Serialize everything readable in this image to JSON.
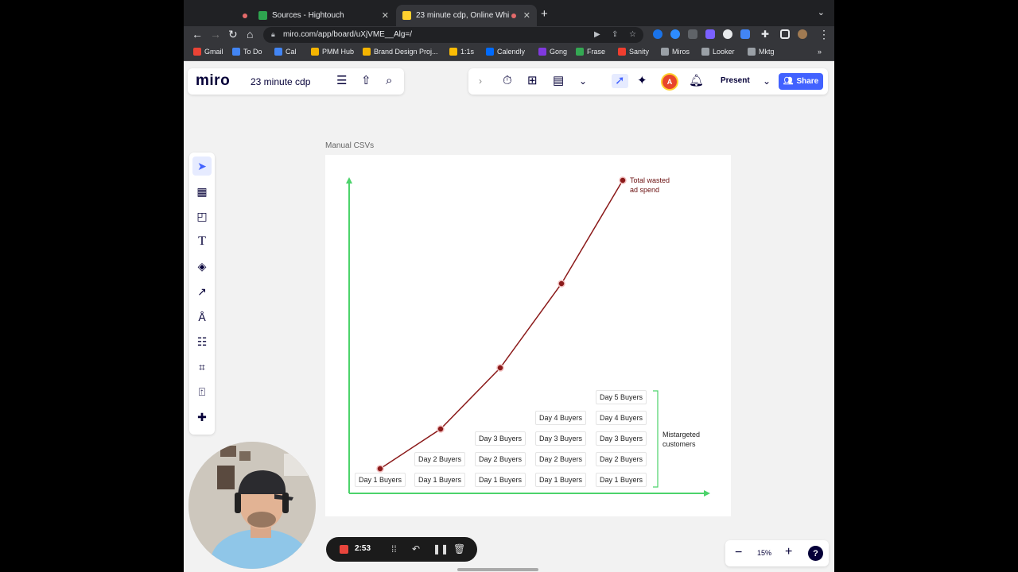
{
  "browser": {
    "tabs": [
      {
        "title": "Sources - Hightouch",
        "favicon_color": "#2ea44f"
      },
      {
        "title": "23 minute cdp, Online Whi",
        "favicon_color": "#ffd02f"
      }
    ],
    "url": "miro.com/app/board/uXjVME__Alg=/",
    "bookmarks": [
      {
        "label": "Gmail",
        "color": "#ea4335"
      },
      {
        "label": "To Do",
        "color": "#4285f4"
      },
      {
        "label": "Cal",
        "color": "#4285f4"
      },
      {
        "label": "PMM Hub",
        "color": "#f4b400"
      },
      {
        "label": "Brand Design Proj...",
        "color": "#f4b400"
      },
      {
        "label": "1:1s",
        "color": "#fbbc04"
      },
      {
        "label": "Calendly",
        "color": "#006bff"
      },
      {
        "label": "Gong",
        "color": "#8039df"
      },
      {
        "label": "Frase",
        "color": "#34a853"
      },
      {
        "label": "Sanity",
        "color": "#f03e2f"
      },
      {
        "label": "Miros",
        "color": "#9aa0a6"
      },
      {
        "label": "Looker",
        "color": "#9aa0a6"
      },
      {
        "label": "Mktg",
        "color": "#9aa0a6"
      }
    ]
  },
  "miro": {
    "logo": "miro",
    "board_title": "23 minute cdp",
    "present_label": "Present",
    "share_label": "Share",
    "avatar_initial": "A",
    "accent": "#4262ff",
    "zoom": "15%",
    "help": "?"
  },
  "board": {
    "frame_label": "Manual CSVs",
    "top_annotation": [
      "Total wasted",
      "ad spend"
    ],
    "side_annotation": [
      "Mistargeted",
      "customers"
    ],
    "line_color": "#8b1a1a",
    "axis_color": "#4cd36b",
    "columns": [
      [
        "Day 1 Buyers"
      ],
      [
        "Day 1 Buyers",
        "Day 2 Buyers"
      ],
      [
        "Day 1 Buyers",
        "Day 2 Buyers",
        "Day 3 Buyers"
      ],
      [
        "Day 1 Buyers",
        "Day 2 Buyers",
        "Day 3 Buyers",
        "Day 4 Buyers"
      ],
      [
        "Day 1 Buyers",
        "Day 2 Buyers",
        "Day 3 Buyers",
        "Day 4 Buyers",
        "Day 5 Buyers"
      ]
    ]
  },
  "recorder": {
    "time": "2:53",
    "rec_color": "#e8453c"
  }
}
